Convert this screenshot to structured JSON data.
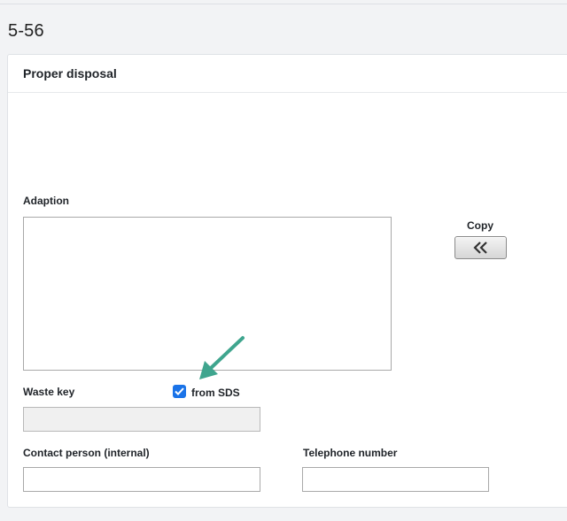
{
  "page": {
    "title": "5-56"
  },
  "section": {
    "title": "Proper disposal"
  },
  "adaption": {
    "label": "Adaption",
    "value": ""
  },
  "copy": {
    "label": "Copy",
    "icon": "double-chevron-left-icon"
  },
  "waste_key": {
    "label": "Waste key",
    "value": "",
    "from_sds_label": "from SDS",
    "from_sds_checked": true
  },
  "contact": {
    "label": "Contact person (internal)",
    "value": ""
  },
  "telephone": {
    "label": "Telephone number",
    "value": ""
  },
  "colors": {
    "checkbox": "#1a73e8",
    "annotation_arrow": "#3fa58e"
  }
}
